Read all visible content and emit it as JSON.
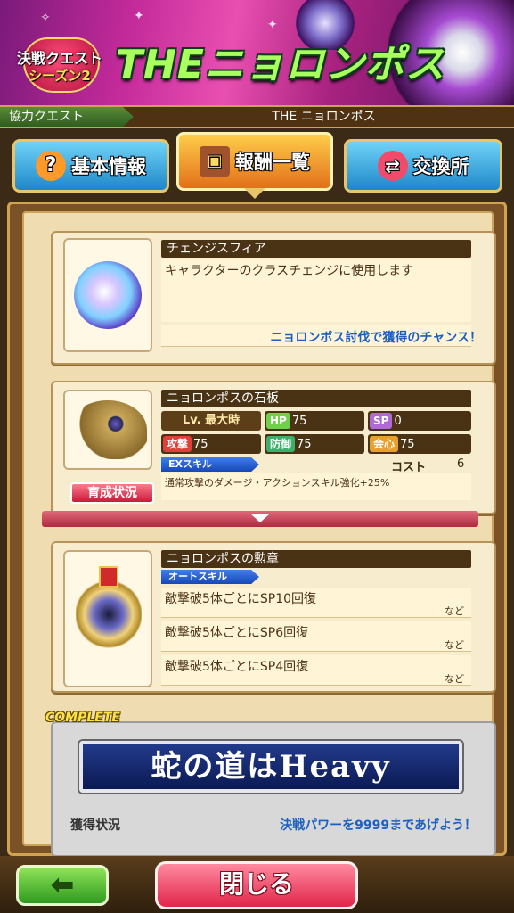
{
  "banner": {
    "season_line1": "決戦クエスト",
    "season_line2": "シーズン2",
    "title": "THEニョロンポス"
  },
  "breadcrumb": {
    "category": "協力クエスト",
    "current": "THE ニョロンポス"
  },
  "tabs": [
    {
      "label": "基本情報",
      "icon": "question-icon"
    },
    {
      "label": "報酬一覧",
      "icon": "treasure-chest-icon"
    },
    {
      "label": "交換所",
      "icon": "exchange-icon"
    }
  ],
  "rewards": [
    {
      "name": "チェンジスフィア",
      "description": "キャラクターのクラスチェンジに使用します",
      "chance": "ニョロンポス討伐で獲得のチャンス！",
      "icon": "sphere-orb-icon"
    },
    {
      "name": "ニョロンポスの石板",
      "level": "Lv. 最大時",
      "stats": {
        "HP": "75",
        "SP": "0",
        "攻撃": "75",
        "防御": "75",
        "会心": "75"
      },
      "skill_tag": "EXスキル",
      "cost_label": "コスト",
      "cost": "6",
      "skill_desc": "通常攻撃のダメージ・アクションスキル強化+25%",
      "growth_button": "育成状況",
      "icon": "stone-tablet-icon"
    },
    {
      "name": "ニョロンポスの勲章",
      "skill_tag": "オートスキル",
      "effects": [
        "敵撃破5体ごとにSP10回復",
        "敵撃破5体ごとにSP6回復",
        "敵撃破5体ごとにSP4回復"
      ],
      "suffix": "など",
      "icon": "medal-icon"
    }
  ],
  "achievement": {
    "complete_label": "COMPLETE",
    "title": "蛇の道はHeavy",
    "status_label": "獲得状況",
    "hint": "決戦パワーを9999まであげよう！"
  },
  "footer": {
    "back_arrow": "⬅",
    "close_label": "閉じる"
  },
  "colors": {
    "blue_text": "#1b5fc4",
    "tab_active": "#f0a030",
    "tab_inactive": "#2a9ad8"
  }
}
